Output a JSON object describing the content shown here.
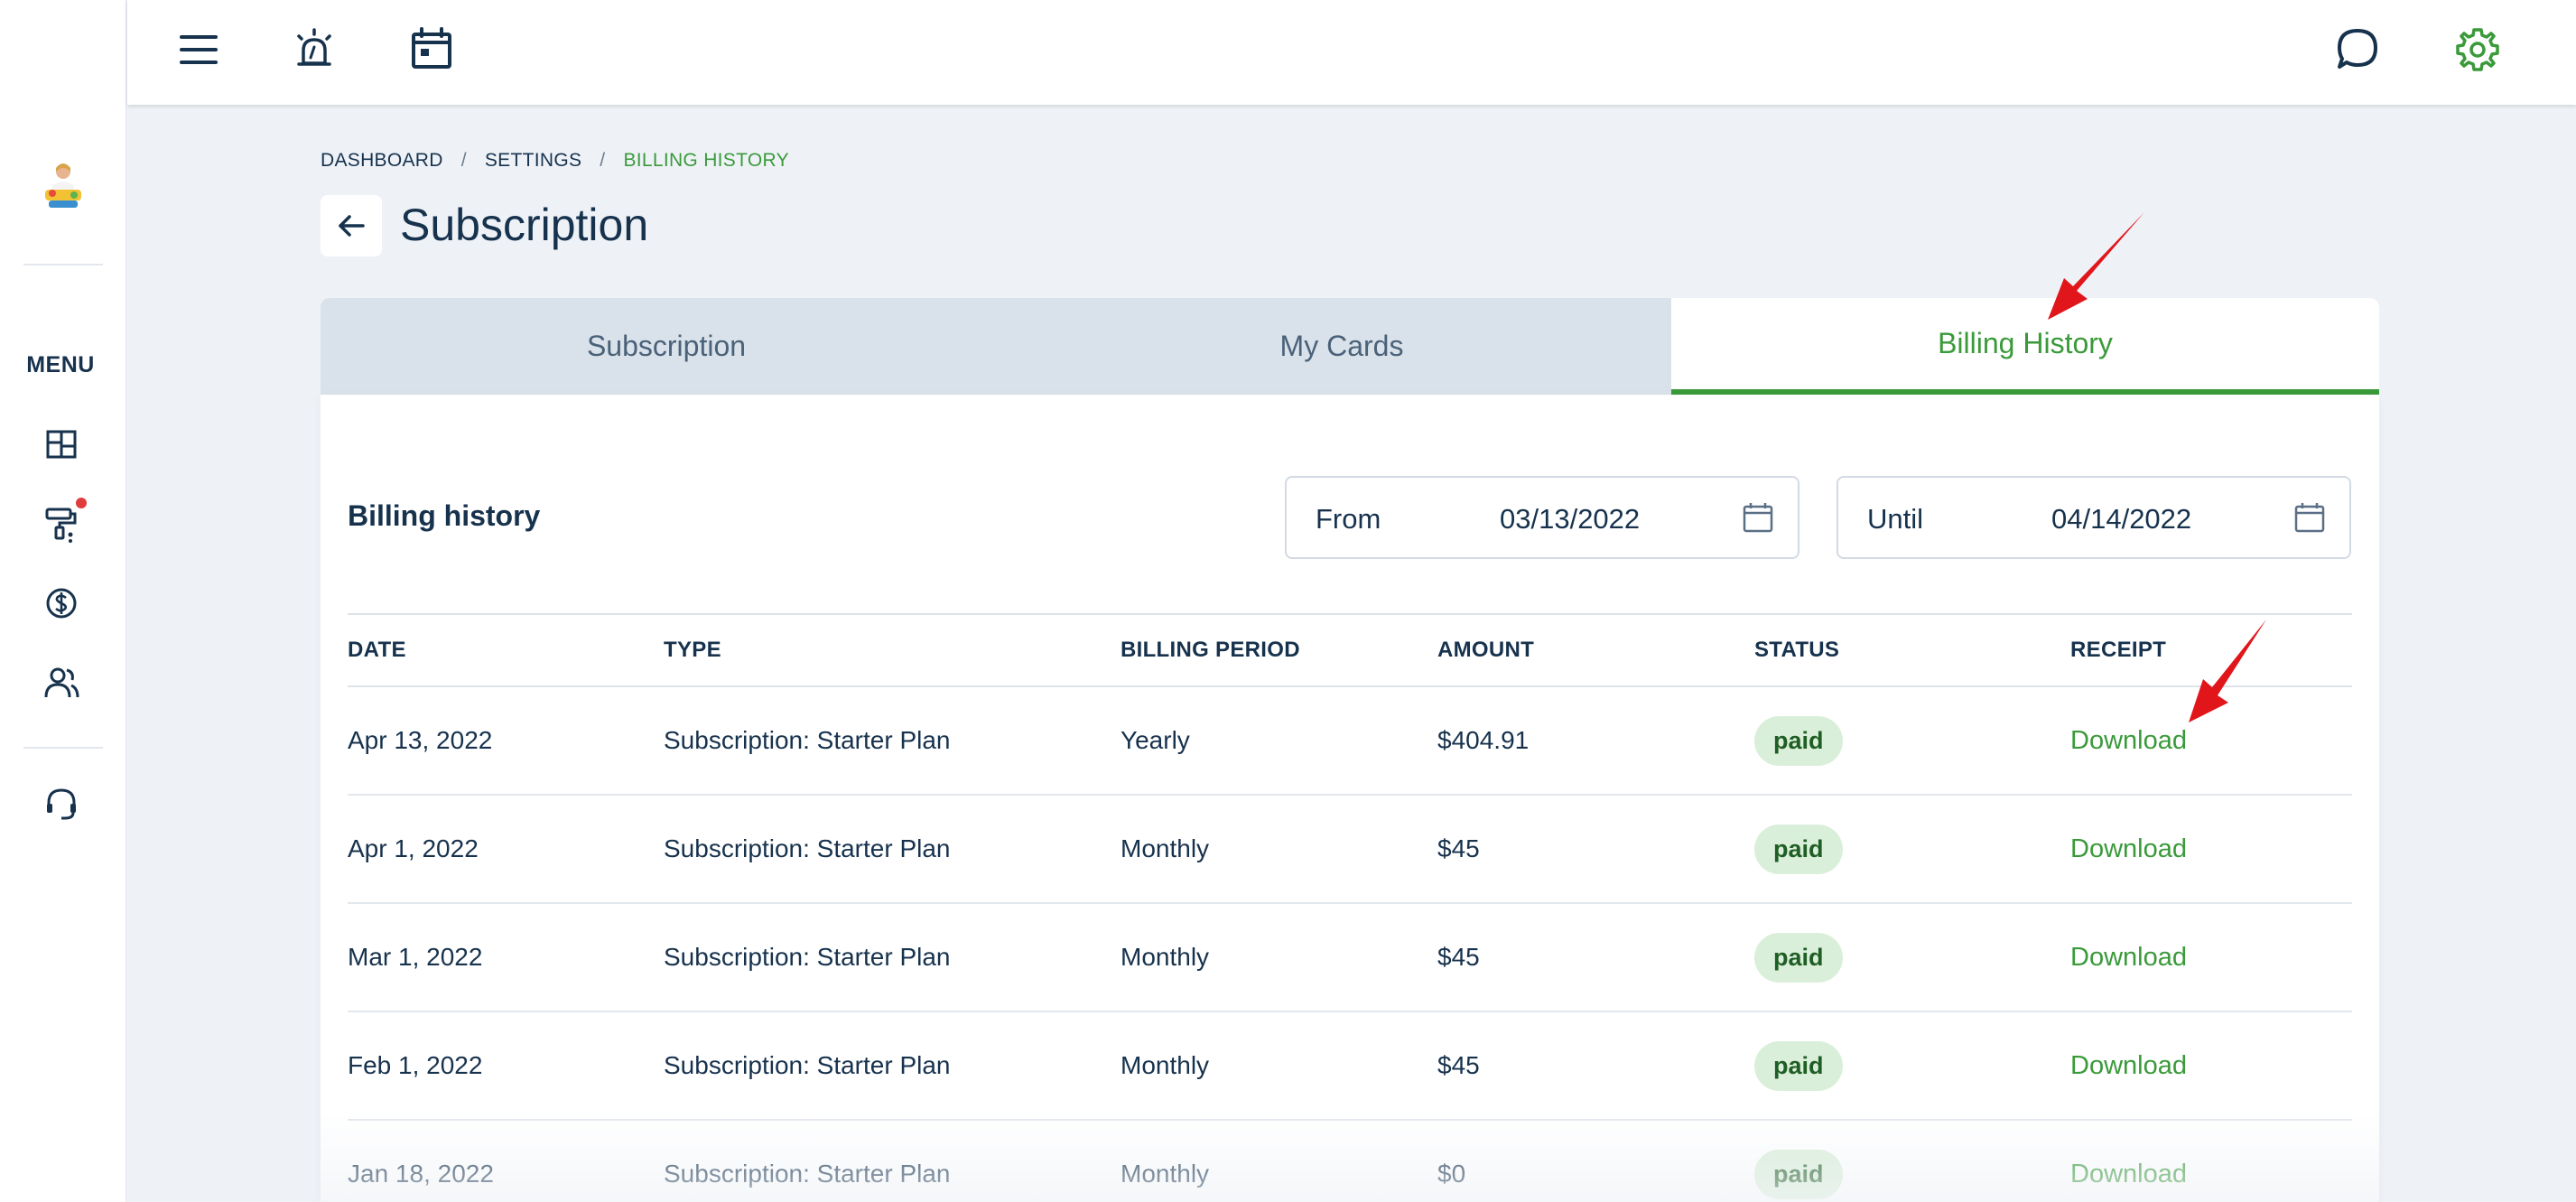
{
  "sidebar": {
    "menu_label": "MENU",
    "icons": [
      "dashboard-icon",
      "paint-roller-icon",
      "dollar-icon",
      "users-icon",
      "headset-icon"
    ]
  },
  "topbar": {
    "icons": [
      "hamburger-menu-icon",
      "alarm-icon",
      "calendar-icon",
      "chat-icon",
      "gear-icon"
    ],
    "accent_color": "#3a9a3a"
  },
  "breadcrumb": {
    "items": [
      "DASHBOARD",
      "SETTINGS",
      "BILLING HISTORY"
    ],
    "separator": "/"
  },
  "page": {
    "title": "Subscription"
  },
  "tabs": [
    {
      "label": "Subscription",
      "active": false
    },
    {
      "label": "My Cards",
      "active": false
    },
    {
      "label": "Billing History",
      "active": true
    }
  ],
  "billing": {
    "section_title": "Billing history",
    "from_label": "From",
    "from_value": "03/13/2022",
    "until_label": "Until",
    "until_value": "04/14/2022",
    "columns": [
      "DATE",
      "TYPE",
      "BILLING PERIOD",
      "AMOUNT",
      "STATUS",
      "RECEIPT"
    ],
    "rows": [
      {
        "date": "Apr 13, 2022",
        "type": "Subscription: Starter Plan",
        "period": "Yearly",
        "amount": "$404.91",
        "status": "paid",
        "receipt": "Download"
      },
      {
        "date": "Apr 1, 2022",
        "type": "Subscription: Starter Plan",
        "period": "Monthly",
        "amount": "$45",
        "status": "paid",
        "receipt": "Download"
      },
      {
        "date": "Mar 1, 2022",
        "type": "Subscription: Starter Plan",
        "period": "Monthly",
        "amount": "$45",
        "status": "paid",
        "receipt": "Download"
      },
      {
        "date": "Feb 1, 2022",
        "type": "Subscription: Starter Plan",
        "period": "Monthly",
        "amount": "$45",
        "status": "paid",
        "receipt": "Download"
      },
      {
        "date": "Jan 18, 2022",
        "type": "Subscription: Starter Plan",
        "period": "Monthly",
        "amount": "$0",
        "status": "paid",
        "receipt": "Download"
      }
    ]
  },
  "colors": {
    "accent": "#3a9a3a",
    "text": "#17324d",
    "background": "#eef2f7",
    "annotation_arrow": "#e0161b",
    "badge_bg": "#daefd9"
  }
}
